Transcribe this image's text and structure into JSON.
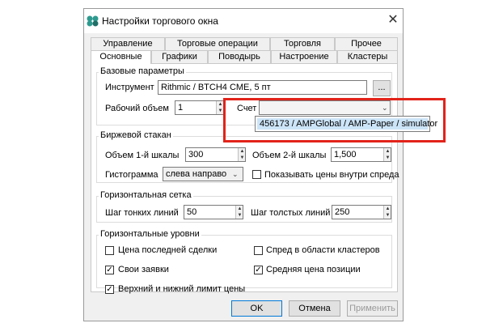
{
  "window": {
    "title": "Настройки торгового окна",
    "close_glyph": "✕"
  },
  "tabs": {
    "row1": [
      "Управление",
      "Торговые операции",
      "Торговля",
      "Прочее"
    ],
    "row2": [
      "Основные",
      "Графики",
      "Поводырь",
      "Настроение",
      "Кластеры"
    ],
    "active": "Основные"
  },
  "basic": {
    "group_label": "Базовые параметры",
    "instrument_label": "Инструмент",
    "instrument_value": "Rithmic / BTCH4 CME, 5 пт",
    "browse_label": "...",
    "volume_label": "Рабочий объем",
    "volume_value": "1",
    "account_label": "Счет",
    "account_value": "",
    "account_option": "456173 / AMPGlobal / AMP-Paper / simulator"
  },
  "orderbook": {
    "group_label": "Биржевой стакан",
    "scale1_label": "Объем 1-й шкалы",
    "scale1_value": "300",
    "scale2_label": "Объем 2-й шкалы",
    "scale2_value": "1,500",
    "histogram_label": "Гистограмма",
    "histogram_value": "слева направо",
    "show_prices_label": "Показывать цены внутри спреда",
    "show_prices_checked": false
  },
  "hgrid": {
    "group_label": "Горизонтальная сетка",
    "thin_label": "Шаг тонких линий",
    "thin_value": "50",
    "thick_label": "Шаг толстых линий",
    "thick_value": "250"
  },
  "hlevels": {
    "group_label": "Горизонтальные уровни",
    "last_trade": {
      "label": "Цена последней сделки",
      "checked": false
    },
    "spread_clusters": {
      "label": "Спред в области кластеров",
      "checked": false
    },
    "my_orders": {
      "label": "Свои заявки",
      "checked": true
    },
    "avg_price": {
      "label": "Средняя цена позиции",
      "checked": true
    },
    "limits": {
      "label": "Верхний и нижний лимит цены",
      "checked": true
    }
  },
  "buttons": {
    "ok": "OK",
    "cancel": "Отмена",
    "apply": "Применить"
  },
  "colors": {
    "highlight": "#e2231a",
    "selection": "#cce4f7",
    "icon": "#2e9a8f"
  }
}
